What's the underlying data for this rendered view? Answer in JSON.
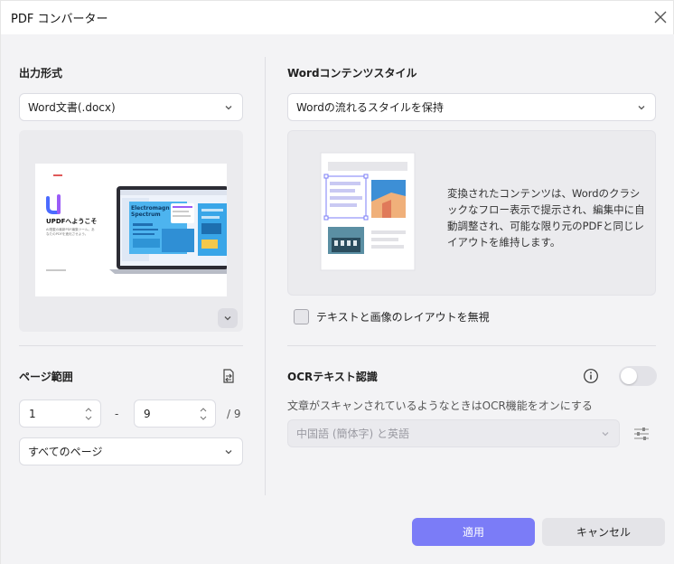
{
  "dialog": {
    "title": "PDF コンバーター"
  },
  "output_format": {
    "heading": "出力形式",
    "selected": "Word文書(.docx)"
  },
  "preview": {
    "brand_heading": "UPDFへようこそ",
    "brand_sub": "AI搭載の最新PDF編集ツール。あなたのPDFを進化させよう。",
    "slide_title": "Electromagnetic Spectrum"
  },
  "page_range": {
    "heading": "ページ範囲",
    "from": "1",
    "to": "9",
    "separator": "-",
    "total": "/ 9",
    "scope": "すべてのページ"
  },
  "word_style": {
    "heading": "Wordコンテンツスタイル",
    "selected": "Wordの流れるスタイルを保持",
    "description": "変換されたコンテンツは、Wordのクラシックなフロー表示で提示され、編集中に自動調整され、可能な限り元のPDFと同じレイアウトを維持します。",
    "ignore_layout_label": "テキストと画像のレイアウトを無視"
  },
  "ocr": {
    "heading": "OCRテキスト認識",
    "enabled": false,
    "hint": "文章がスキャンされているようなときはOCR機能をオンにする",
    "language": "中国語 (簡体字) と英語"
  },
  "buttons": {
    "apply": "適用",
    "cancel": "キャンセル"
  },
  "colors": {
    "accent": "#7b7cf7",
    "panel": "#f3f3f5"
  }
}
